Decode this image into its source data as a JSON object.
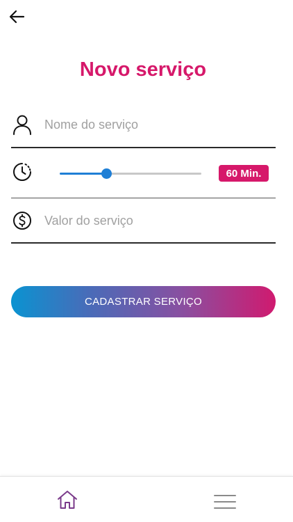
{
  "header": {
    "back_icon": "arrow-left-icon",
    "title": "Novo serviço"
  },
  "form": {
    "name_field": {
      "icon": "user-icon",
      "value": "",
      "placeholder": "Nome do serviço"
    },
    "duration": {
      "icon": "clock-icon",
      "slider_fraction": 0.33,
      "badge_label": "60 Min."
    },
    "price_field": {
      "icon": "dollar-circle-icon",
      "value": "",
      "placeholder": "Valor do serviço"
    },
    "submit_label": "CADASTRAR SERVIÇO"
  },
  "bottom_nav": {
    "home_icon": "home-icon",
    "menu_icon": "hamburger-menu-icon"
  },
  "colors": {
    "accent": "#d6186a",
    "slider": "#1f7fd6",
    "gradient_start": "#0a93d1",
    "gradient_end": "#d01a6f",
    "nav_icon": "#7a3a8a"
  }
}
